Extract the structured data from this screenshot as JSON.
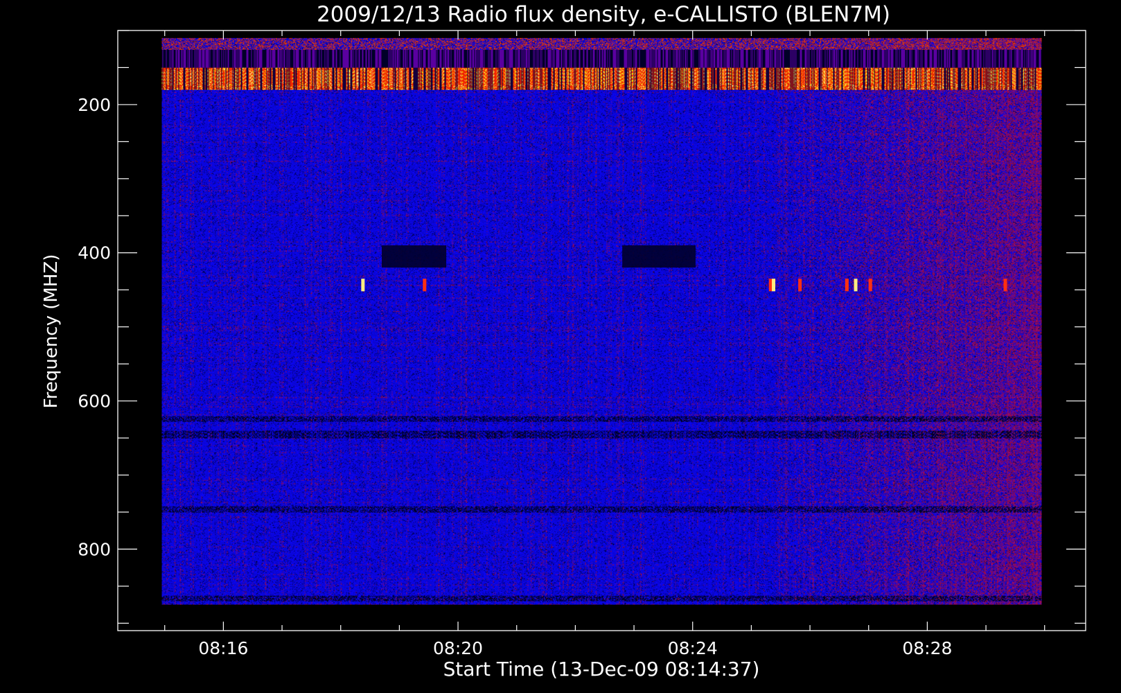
{
  "chart_data": {
    "type": "heatmap",
    "title": "2009/12/13  Radio flux density, e-CALLISTO (BLEN7M)",
    "xlabel": "Start Time (13-Dec-09 08:14:37)",
    "ylabel": "Frequency (MHZ)",
    "x_ticks": [
      "08:16",
      "08:20",
      "08:24",
      "08:28"
    ],
    "x_tick_minutes": [
      16,
      20,
      24,
      28
    ],
    "y_ticks": [
      200,
      400,
      600,
      800
    ],
    "xlim_minutes": [
      14.2,
      30.7
    ],
    "ylim_mhz": [
      100,
      910
    ],
    "data_extent": {
      "time_minutes": [
        14.95,
        29.95
      ],
      "freq_mhz": [
        110,
        875
      ]
    },
    "y_inverted": true,
    "grid": false,
    "colorscale": [
      "#000000",
      "#0000ff",
      "#8b0000",
      "#ff2000",
      "#ffff80"
    ],
    "features": [
      {
        "name": "rfi-band-top",
        "freq_mhz": [
          110,
          180
        ],
        "time_minutes": [
          14.95,
          29.95
        ]
      },
      {
        "name": "absorption-block-1",
        "freq_mhz": [
          390,
          420
        ],
        "time_minutes": [
          18.7,
          19.8
        ]
      },
      {
        "name": "absorption-block-2",
        "freq_mhz": [
          390,
          420
        ],
        "time_minutes": [
          22.8,
          24.05
        ]
      },
      {
        "name": "emission-spots",
        "freq_mhz": [
          435,
          452
        ],
        "time_minutes": [
          18.3,
          29.5
        ]
      }
    ]
  }
}
